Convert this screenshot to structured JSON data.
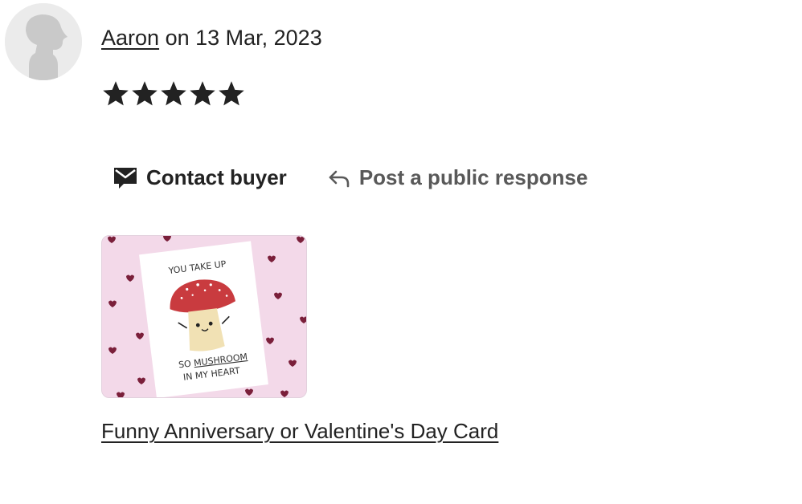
{
  "review": {
    "reviewer_name": "Aaron",
    "date_prefix": " on ",
    "date": "13 Mar, 2023",
    "rating": 5,
    "rating_max": 5
  },
  "actions": {
    "contact_label": "Contact buyer",
    "respond_label": "Post a public response"
  },
  "product": {
    "card_line_1": "YOU TAKE UP",
    "card_line_2_prefix": "SO ",
    "card_line_2_emph": "MUSHROOM",
    "card_line_3": "IN MY HEART",
    "link_label": "Funny Anniversary or Valentine's Day Card"
  },
  "icons": {
    "avatar": "person-silhouette-icon",
    "star": "star-icon",
    "contact": "message-envelope-icon",
    "respond": "reply-arrow-icon"
  },
  "colors": {
    "text": "#222222",
    "muted_text": "#595959",
    "avatar_bg": "#ebebeb",
    "thumb_bg": "#f3d9e9",
    "mushroom_cap": "#c93b3f"
  }
}
